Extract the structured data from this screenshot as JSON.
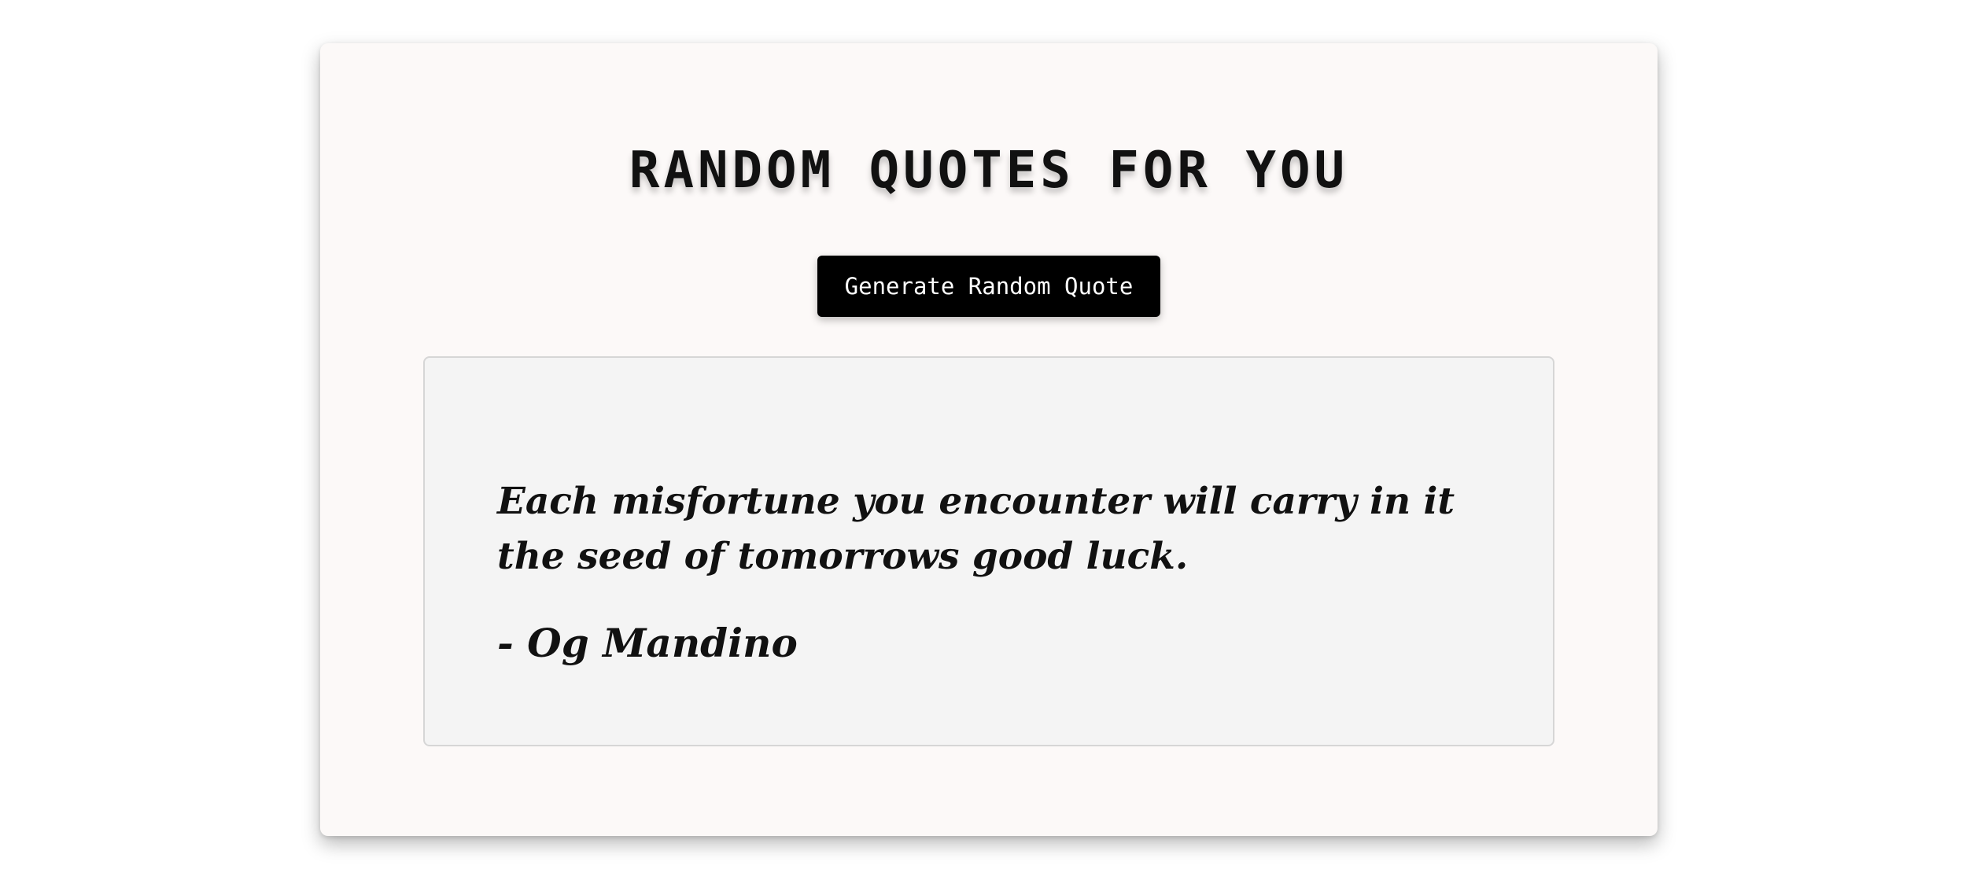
{
  "header": {
    "title": "RANDOM QUOTES FOR YOU"
  },
  "actions": {
    "generate_label": "Generate Random Quote"
  },
  "quote": {
    "text": "Each misfortune you encounter will carry in it the seed of tomorrows good luck.",
    "author": "- Og Mandino"
  },
  "colors": {
    "card_background": "#fcf9f8",
    "button_background": "#000000",
    "quote_box_background": "#f4f4f4"
  }
}
